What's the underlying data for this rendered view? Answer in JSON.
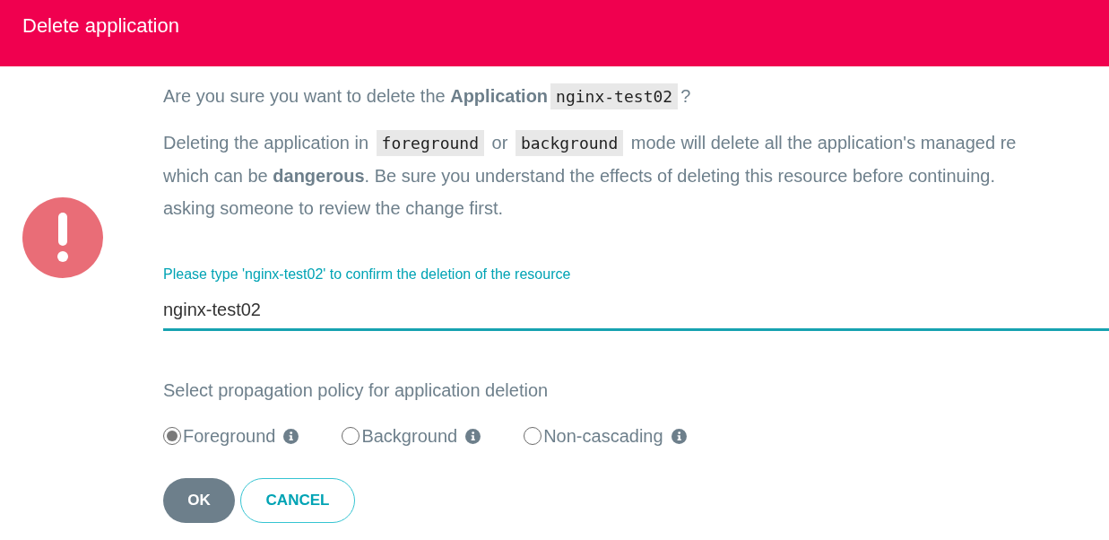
{
  "dialog": {
    "title": "Delete application"
  },
  "question": [
    {
      "kind": "text",
      "text": "Are you sure you want to delete the "
    },
    {
      "kind": "bold",
      "text": "Application"
    },
    {
      "kind": "code",
      "text": "nginx-test02"
    },
    {
      "kind": "text",
      "text": "?"
    }
  ],
  "paragraph_lines": [
    [
      {
        "kind": "text",
        "text": "Deleting the application in "
      },
      {
        "kind": "code",
        "text": "foreground"
      },
      {
        "kind": "text",
        "text": " or "
      },
      {
        "kind": "code",
        "text": "background"
      },
      {
        "kind": "text",
        "text": " mode will delete all the application's managed re"
      }
    ],
    [
      {
        "kind": "text",
        "text": "which can be "
      },
      {
        "kind": "bold",
        "text": "dangerous"
      },
      {
        "kind": "text",
        "text": ". Be sure you understand the effects of deleting this resource before continuing."
      }
    ],
    [
      {
        "kind": "text",
        "text": "asking someone to review the change first."
      }
    ]
  ],
  "confirm_field": {
    "label": "Please type 'nginx-test02' to confirm the deletion of the resource",
    "value": "nginx-test02"
  },
  "propagation": {
    "label": "Select propagation policy for application deletion",
    "options": [
      {
        "label": "Foreground",
        "selected": true
      },
      {
        "label": "Background",
        "selected": false
      },
      {
        "label": "Non-cascading",
        "selected": false
      }
    ]
  },
  "buttons": [
    {
      "label": "OK",
      "kind": "primary"
    },
    {
      "label": "CANCEL",
      "kind": "secondary"
    }
  ]
}
